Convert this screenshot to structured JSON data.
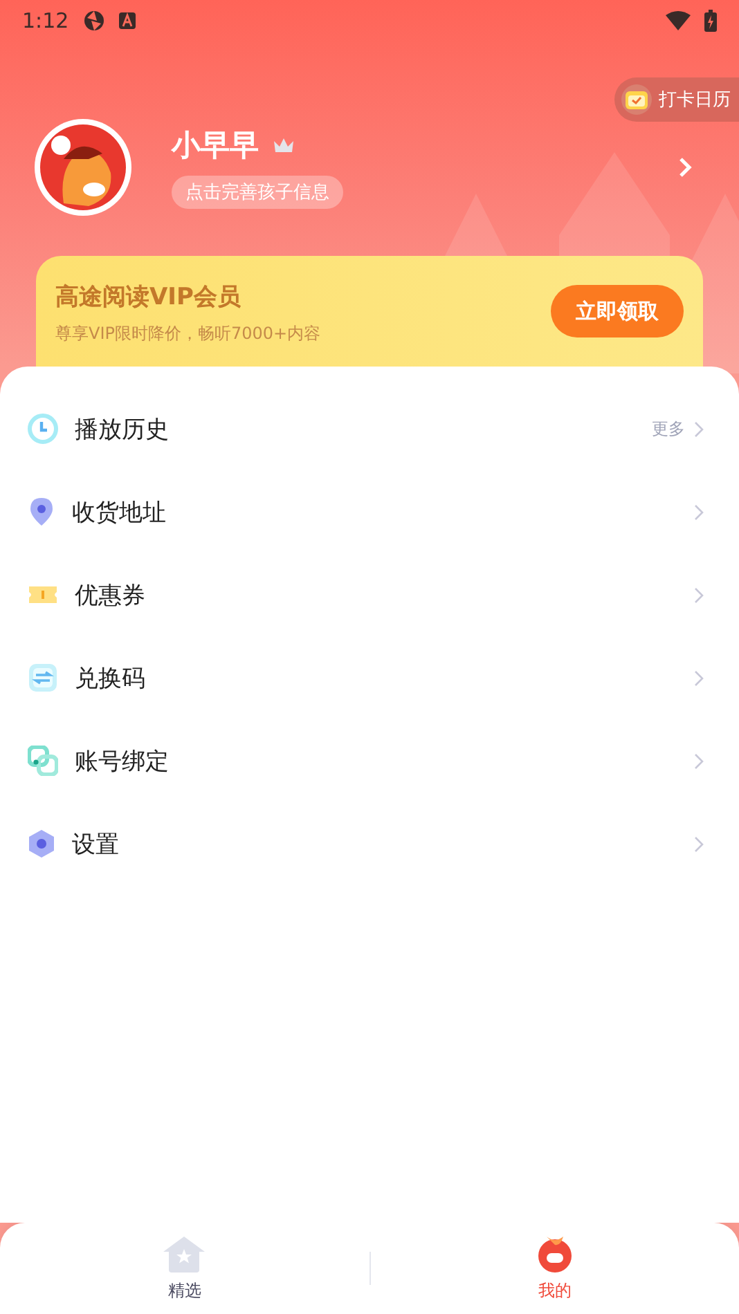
{
  "status_bar": {
    "time": "1:12"
  },
  "checkin": {
    "label": "打卡日历"
  },
  "profile": {
    "name": "小早早",
    "hint": "点击完善孩子信息"
  },
  "vip": {
    "title": "高途阅读VIP会员",
    "subtitle": "尊享VIP限时降价，畅听7000+内容",
    "button": "立即领取"
  },
  "menu": [
    {
      "kind": "history",
      "label": "播放历史",
      "more": "更多"
    },
    {
      "kind": "address",
      "label": "收货地址"
    },
    {
      "kind": "coupon",
      "label": "优惠券"
    },
    {
      "kind": "redeem",
      "label": "兑换码"
    },
    {
      "kind": "binding",
      "label": "账号绑定"
    },
    {
      "kind": "settings",
      "label": "设置"
    }
  ],
  "tabs": [
    {
      "kind": "home",
      "label": "精选",
      "selected": false
    },
    {
      "kind": "me",
      "label": "我的",
      "selected": true
    }
  ]
}
